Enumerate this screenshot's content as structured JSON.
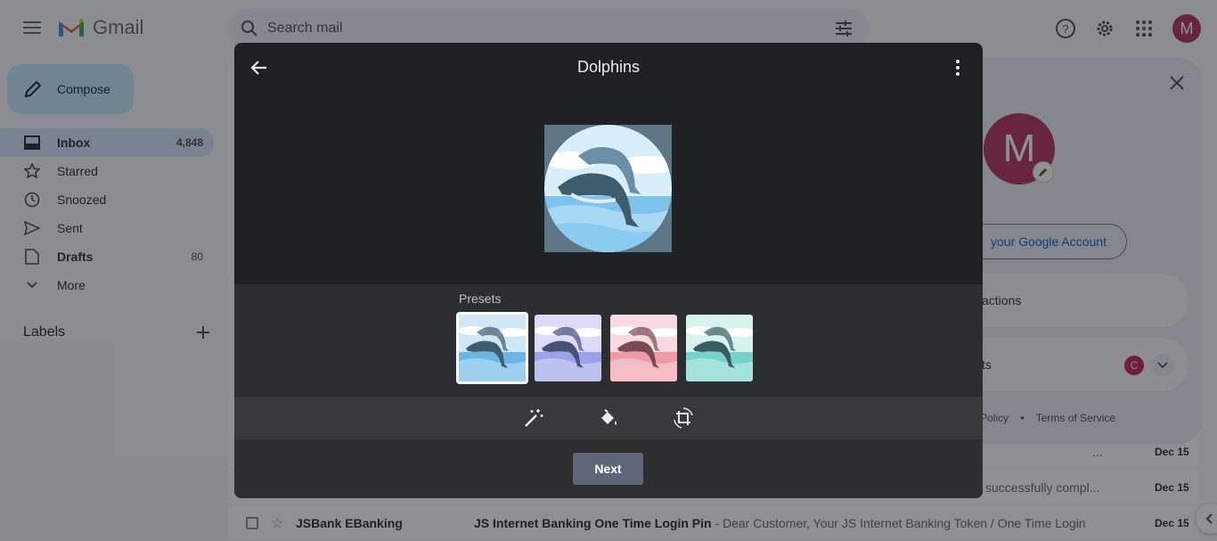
{
  "app": {
    "name": "Gmail"
  },
  "search": {
    "placeholder": "Search mail"
  },
  "user": {
    "initial": "M"
  },
  "compose": {
    "label": "Compose"
  },
  "nav": [
    {
      "label": "Inbox",
      "count": "4,848",
      "icon": "inbox-icon",
      "active": true
    },
    {
      "label": "Starred",
      "count": "",
      "icon": "star-icon"
    },
    {
      "label": "Snoozed",
      "count": "",
      "icon": "clock-icon"
    },
    {
      "label": "Sent",
      "count": "",
      "icon": "send-icon"
    },
    {
      "label": "Drafts",
      "count": "80",
      "icon": "draft-icon"
    },
    {
      "label": "More",
      "count": "",
      "icon": "chevron-down-icon"
    }
  ],
  "labels": {
    "title": "Labels"
  },
  "mail_rows": [
    {
      "snippet": "...",
      "date": "Dec 15"
    },
    {
      "snippet": "successfully compl...",
      "date": "Dec 15"
    },
    {
      "sender": "JSBank EBanking",
      "subject": "JS Internet Banking One Time Login Pin",
      "snippet": " - Dear Customer, Your JS Internet Banking Token / One Time Login",
      "date": "Dec 15"
    }
  ],
  "account_card": {
    "avatar_initial": "M",
    "manage_label": "your Google Account",
    "section1": "actions",
    "section2": "ts",
    "mini_avatar": "C",
    "footer_privacy": "Policy",
    "footer_sep": "•",
    "footer_terms": "Terms of Service"
  },
  "dialog": {
    "title": "Dolphins",
    "presets_label": "Presets",
    "next_label": "Next",
    "presets": [
      {
        "name": "blue",
        "sky": "#cfe7f7",
        "sea": "#69b6e6",
        "dolphin": "#3f5b6e",
        "selected": true
      },
      {
        "name": "violet",
        "sky": "#dcdcf8",
        "sea": "#9aa3ea",
        "dolphin": "#4a4f78",
        "selected": false
      },
      {
        "name": "pink",
        "sky": "#f8dbe0",
        "sea": "#ef9aa6",
        "dolphin": "#7a4a52",
        "selected": false
      },
      {
        "name": "teal",
        "sky": "#d5f3ef",
        "sea": "#74d4cb",
        "dolphin": "#3b5c62",
        "selected": false
      }
    ],
    "tools": [
      "magic-wand-icon",
      "paint-bucket-icon",
      "crop-rotate-icon"
    ]
  }
}
